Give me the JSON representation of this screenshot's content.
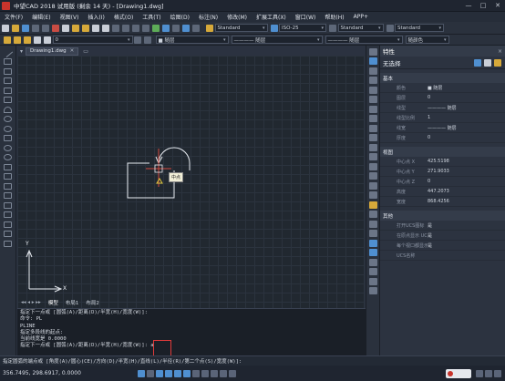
{
  "window": {
    "title": "中望CAD 2018 试用版 (剩余 14 天) - [Drawing1.dwg]",
    "controls": [
      "—",
      "□",
      "✕"
    ]
  },
  "menu": [
    "文件(F)",
    "编辑(E)",
    "视图(V)",
    "插入(I)",
    "格式(O)",
    "工具(T)",
    "绘图(D)",
    "标注(N)",
    "修改(M)",
    "扩展工具(X)",
    "窗口(W)",
    "帮助(H)",
    "APP+"
  ],
  "toolbar1": {
    "textstyle": "Standard",
    "dimstyle": "ISO-25",
    "tablestyle": "Standard",
    "mleaderstyle": "Standard"
  },
  "toolbar2": {
    "layer": "0",
    "color": "■ 随层",
    "linetype": "———— 随层",
    "lineweight": "———— 随层",
    "plotstyle": "随颜色"
  },
  "doc_tab": "Drawing1.dwg",
  "layout_tabs": [
    "模型",
    "布局1",
    "布局2"
  ],
  "canvas": {
    "cursor_label": "中点",
    "ucs_x": "X",
    "ucs_y": "Y"
  },
  "properties": {
    "title": "特性",
    "close": "×",
    "selection": "无选择",
    "sections": {
      "basic": "基本",
      "geometry": "视图",
      "misc": "其他"
    },
    "basic_rows": [
      {
        "k": "颜色",
        "v": "■ 随层"
      },
      {
        "k": "图层",
        "v": "0"
      },
      {
        "k": "线型",
        "v": "———— 随层"
      },
      {
        "k": "线型比例",
        "v": "1"
      },
      {
        "k": "线宽",
        "v": "———— 随层"
      },
      {
        "k": "厚度",
        "v": "0"
      }
    ],
    "view_rows": [
      {
        "k": "中心点 X",
        "v": "425.5198"
      },
      {
        "k": "中心点 Y",
        "v": "271.9033"
      },
      {
        "k": "中心点 Z",
        "v": "0"
      },
      {
        "k": "高度",
        "v": "447.2073"
      },
      {
        "k": "宽度",
        "v": "868.4256"
      }
    ],
    "misc_rows": [
      {
        "k": "打开UCS图标",
        "v": "是"
      },
      {
        "k": "在原点显示 UCS ...",
        "v": "是"
      },
      {
        "k": "每个视口都显示 U...",
        "v": "是"
      },
      {
        "k": "UCS名称",
        "v": ""
      }
    ]
  },
  "command_history": [
    "指定下一点或 [圆弧(A)/距离(D)/半宽(H)/宽度(W)]:",
    "命令: PL",
    "PLINE",
    "指定多段线的起点:",
    "当前线宽是 0.0000",
    "指定下一点或 [圆弧(A)/距离(D)/半宽(H)/宽度(W)]: a"
  ],
  "command_prompt": "指定圆弧的端点或 [角度(A)/圆心(CE)/方向(D)/半宽(H)/直线(L)/半径(R)/第二个点(S)/宽度(W)]:",
  "status": {
    "coords": "356.7495, 298.6917, 0.0000"
  }
}
